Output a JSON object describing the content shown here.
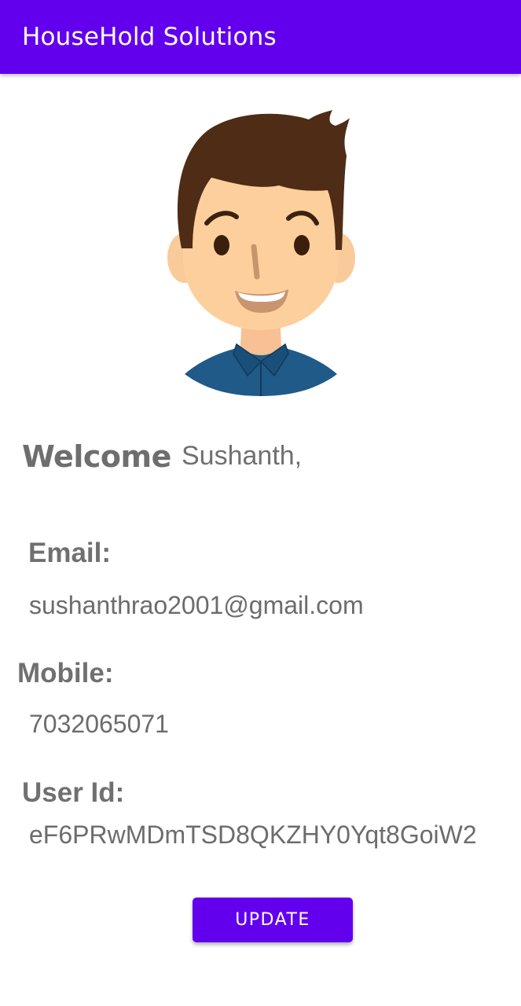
{
  "app_bar": {
    "title": "HouseHold Solutions",
    "background_color": "#6200ee"
  },
  "profile": {
    "avatar_icon": "cartoon-man-avatar",
    "welcome_label": "Welcome",
    "user_name": "Sushanth,"
  },
  "details": {
    "email_label": "Email:",
    "email_value": "sushanthrao2001@gmail.com",
    "mobile_label": "Mobile:",
    "mobile_value": "7032065071",
    "user_id_label": "User Id:",
    "user_id_value": "eF6PRwMDmTSD8QKZHY0Yqt8GoiW2"
  },
  "actions": {
    "update_label": "UPDATE",
    "accent_color": "#6200ee"
  }
}
